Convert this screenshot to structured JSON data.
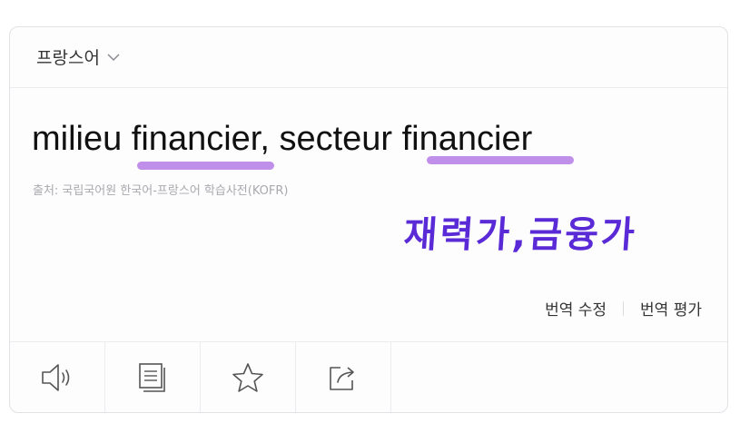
{
  "header": {
    "language": "프랑스어",
    "icon": "chevron-down-icon"
  },
  "translation": {
    "text": "milieu financier, secteur financier"
  },
  "source_label": "출처: 국립국어원 한국어-프랑스어 학습사전(KOFR)",
  "annotation": {
    "handwritten": "재력가,금융가",
    "color": "#5a2ad6",
    "highlight_color": "#b57be6"
  },
  "actions": {
    "edit_label": "번역 수정",
    "rate_label": "번역 평가"
  },
  "toolbar": {
    "icons": [
      "speaker-icon",
      "copy-icon",
      "star-icon",
      "share-icon"
    ]
  }
}
